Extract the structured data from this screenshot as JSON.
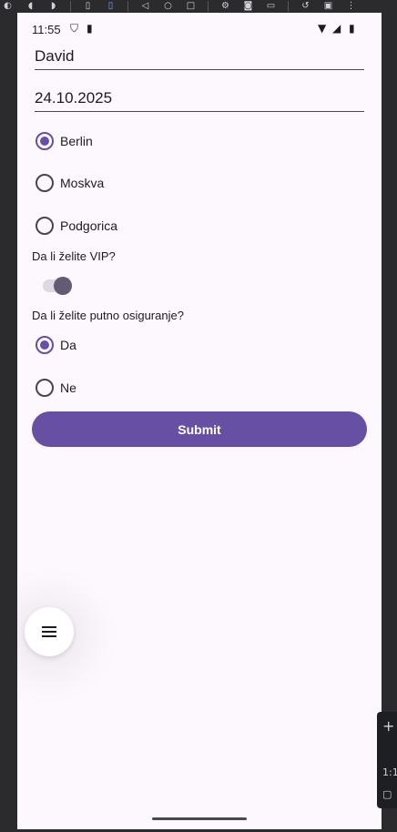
{
  "toolbar": {
    "icons": [
      "speaker-icon",
      "volume-up-icon",
      "volume-down-icon",
      "fold-icon",
      "fold-active-icon",
      "back-icon",
      "home-icon",
      "overview-icon",
      "rotate-settings-icon",
      "camera-icon",
      "video-icon",
      "undo-icon",
      "wifi-icon",
      "more-icon"
    ]
  },
  "status_bar": {
    "time": "11:55"
  },
  "form": {
    "name_value": "David",
    "date_value": "24.10.2025",
    "cities": [
      {
        "label": "Berlin",
        "selected": true
      },
      {
        "label": "Moskva",
        "selected": false
      },
      {
        "label": "Podgorica",
        "selected": false
      }
    ],
    "vip_question": "Da li želite VIP?",
    "vip_enabled": true,
    "insurance_question": "Da li želite putno osiguranje?",
    "insurance_options": [
      {
        "label": "Da",
        "selected": true
      },
      {
        "label": "Ne",
        "selected": false
      }
    ],
    "submit_label": "Submit"
  },
  "fab": {
    "icon": "menu-icon"
  },
  "zoom_panel": {
    "ratio_label": "1:1"
  },
  "colors": {
    "accent": "#6750a4",
    "background": "#fdf7fe",
    "frame": "#2b2b2e"
  }
}
